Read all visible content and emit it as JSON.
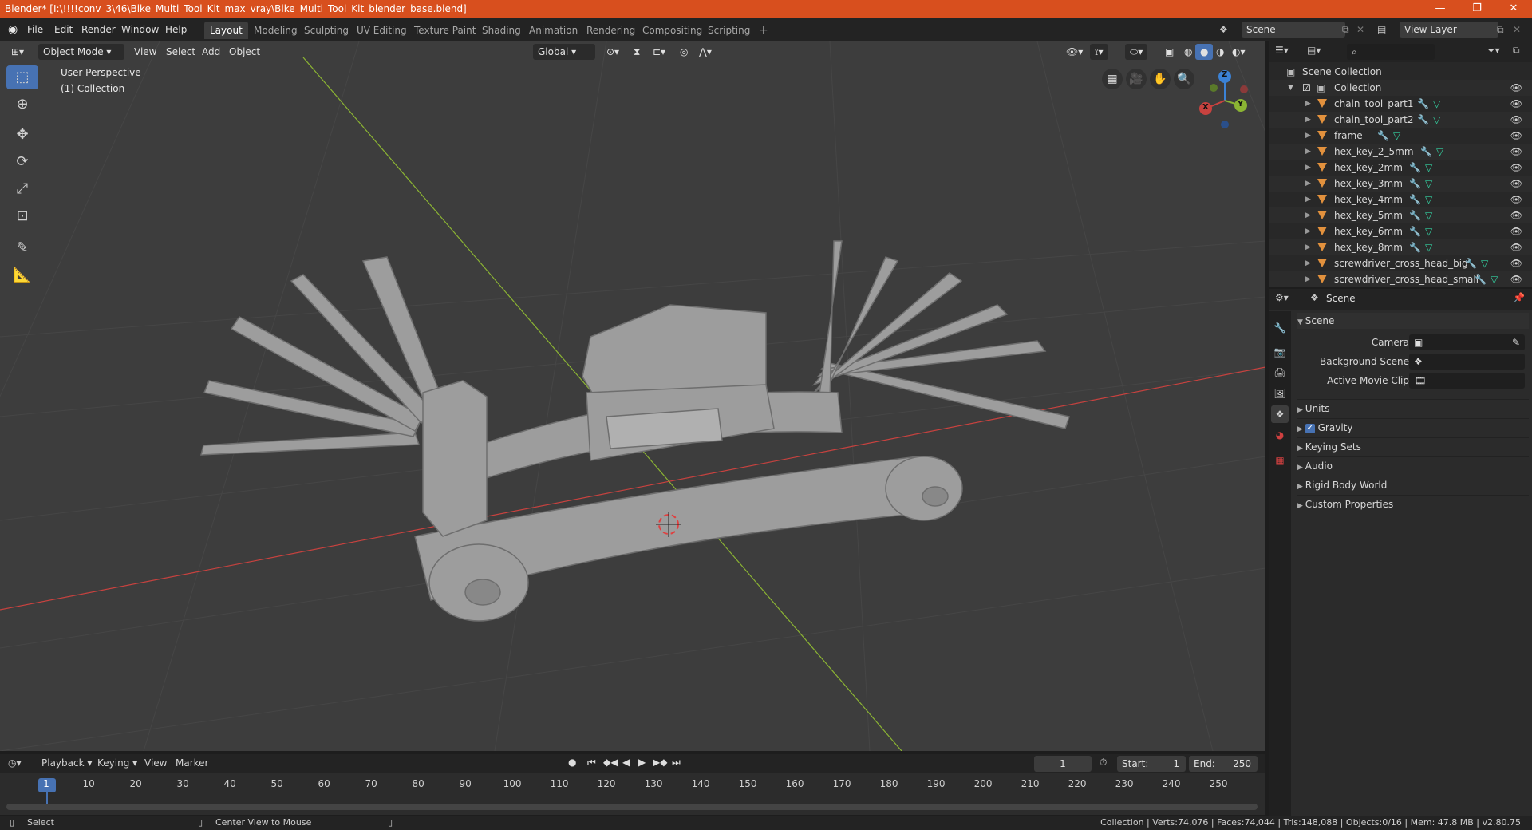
{
  "titlebar": {
    "title": "Blender* [I:\\!!!!conv_3\\46\\Bike_Multi_Tool_Kit_max_vray\\Bike_Multi_Tool_Kit_blender_base.blend]",
    "minimize": "—",
    "maximize": "❐",
    "close": "✕"
  },
  "menu": {
    "file": "File",
    "edit": "Edit",
    "render": "Render",
    "window": "Window",
    "help": "Help"
  },
  "workspaces": [
    "Layout",
    "Modeling",
    "Sculpting",
    "UV Editing",
    "Texture Paint",
    "Shading",
    "Animation",
    "Rendering",
    "Compositing",
    "Scripting"
  ],
  "add_workspace": "+",
  "scene_field": "Scene",
  "view_layer_field": "View Layer",
  "viewport": {
    "mode": "Object Mode",
    "view": "View",
    "select": "Select",
    "add": "Add",
    "object": "Object",
    "transform_orientation": "Global",
    "perspective_label": "User Perspective",
    "collection_label": "(1) Collection",
    "gizmo": {
      "z": "Z",
      "y": "Y",
      "x": "X"
    }
  },
  "outliner": {
    "search_placeholder": "",
    "scene_collection": "Scene Collection",
    "collection": "Collection",
    "objects": [
      "chain_tool_part1",
      "chain_tool_part2",
      "frame",
      "hex_key_2_5mm",
      "hex_key_2mm",
      "hex_key_3mm",
      "hex_key_4mm",
      "hex_key_5mm",
      "hex_key_6mm",
      "hex_key_8mm",
      "screwdriver_cross_head_big",
      "screwdriver_cross_head_small"
    ]
  },
  "properties": {
    "header": "Scene",
    "panel_title": "Scene",
    "camera_label": "Camera",
    "background_scene_label": "Background Scene",
    "active_movie_clip_label": "Active Movie Clip",
    "sections": [
      "Units",
      "Gravity",
      "Keying Sets",
      "Audio",
      "Rigid Body World",
      "Custom Properties"
    ],
    "gravity_checked": true
  },
  "timeline": {
    "playback": "Playback",
    "keying": "Keying",
    "view": "View",
    "marker": "Marker",
    "current_frame": "1",
    "start_label": "Start:",
    "start_value": "1",
    "end_label": "End:",
    "end_value": "250",
    "ruler": [
      "1",
      "10",
      "20",
      "30",
      "40",
      "50",
      "60",
      "70",
      "80",
      "90",
      "100",
      "110",
      "120",
      "130",
      "140",
      "150",
      "160",
      "170",
      "180",
      "190",
      "200",
      "210",
      "220",
      "230",
      "240",
      "250"
    ]
  },
  "statusbar": {
    "select": "Select",
    "center_view": "Center View to Mouse",
    "stats": "Collection | Verts:74,076 | Faces:74,044 | Tris:148,088 | Objects:0/16 | Mem: 47.8 MB | v2.80.75"
  },
  "colors": {
    "titlebar": "#d84f1e",
    "accent_blue": "#4772b3",
    "object_orange": "#e2913d",
    "mesh_green": "#34d3a2",
    "axis_x": "#c8423f",
    "axis_y": "#8bb433",
    "axis_z": "#3b82d6"
  }
}
